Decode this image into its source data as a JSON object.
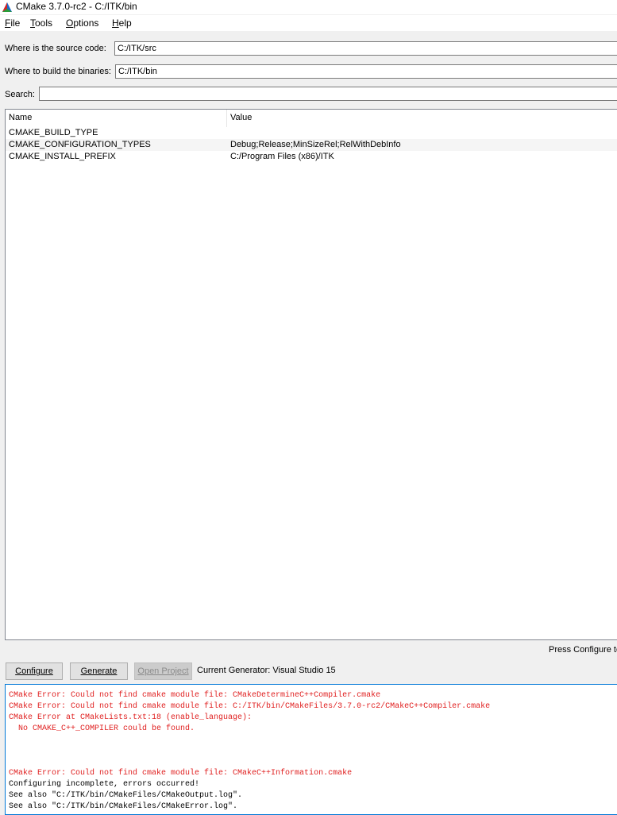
{
  "window": {
    "title": "CMake 3.7.0-rc2 - C:/ITK/bin"
  },
  "menu": [
    "File",
    "Tools",
    "Options",
    "Help"
  ],
  "paths": {
    "source_label": "Where is the source code:",
    "source_value": "C:/ITK/src",
    "build_label": "Where to build the binaries:",
    "build_value": "C:/ITK/bin"
  },
  "search": {
    "label": "Search:",
    "value": ""
  },
  "cache": {
    "columns": [
      "Name",
      "Value"
    ],
    "rows": [
      {
        "name": "CMAKE_BUILD_TYPE",
        "value": ""
      },
      {
        "name": "CMAKE_CONFIGURATION_TYPES",
        "value": "Debug;Release;MinSizeRel;RelWithDebInfo"
      },
      {
        "name": "CMAKE_INSTALL_PREFIX",
        "value": "C:/Program Files (x86)/ITK"
      }
    ]
  },
  "hint": "Press Configure to",
  "buttons": {
    "configure": "Configure",
    "generate": "Generate",
    "open_project": "Open Project"
  },
  "generator": "Current Generator: Visual Studio 15",
  "output": [
    {
      "type": "err",
      "text": "CMake Error: Could not find cmake module file: CMakeDetermineC++Compiler.cmake"
    },
    {
      "type": "err",
      "text": "CMake Error: Could not find cmake module file: C:/ITK/bin/CMakeFiles/3.7.0-rc2/CMakeC++Compiler.cmake"
    },
    {
      "type": "err",
      "text": "CMake Error at CMakeLists.txt:18 (enable_language):"
    },
    {
      "type": "err",
      "text": "  No CMAKE_C++_COMPILER could be found."
    },
    {
      "type": "err",
      "text": "CMake Error: Could not find cmake module file: CMakeC++Information.cmake"
    },
    {
      "type": "msg",
      "text": "Configuring incomplete, errors occurred!"
    },
    {
      "type": "msg",
      "text": "See also \"C:/ITK/bin/CMakeFiles/CMakeOutput.log\"."
    },
    {
      "type": "msg",
      "text": "See also \"C:/ITK/bin/CMakeFiles/CMakeError.log\"."
    }
  ],
  "colors": {
    "error": "#e02020",
    "accent": "#0078d7"
  }
}
